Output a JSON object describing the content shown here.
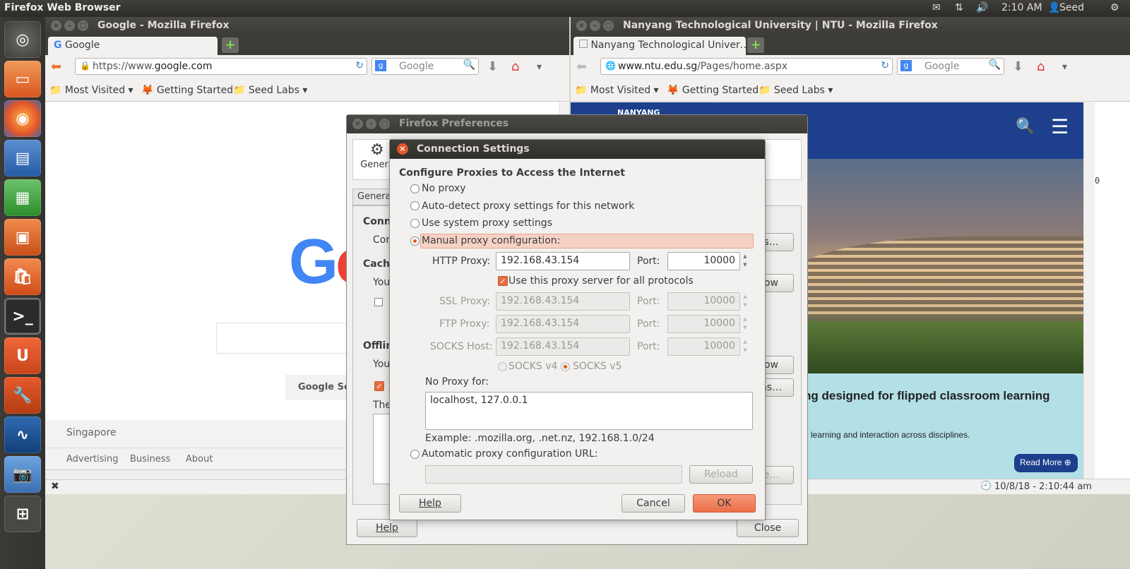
{
  "topbar": {
    "app_name": "Firefox Web Browser",
    "time": "2:10 AM",
    "user": "Seed"
  },
  "left_window": {
    "title": "Google - Mozilla Firefox",
    "tab": "Google",
    "url_prefix": "https://www.",
    "url_domain": "google.com",
    "search_placeholder": "Google",
    "bookmarks": [
      "Most Visited",
      "Getting Started",
      "Seed Labs"
    ],
    "content": {
      "logo": "Go",
      "search_button": "Google Sea",
      "footer_region": "Singapore",
      "footer_links": [
        "Advertising",
        "Business",
        "About"
      ]
    }
  },
  "right_window": {
    "title": "Nanyang Technological University | NTU - Mozilla Firefox",
    "tab": "Nanyang Technological Univer…",
    "url_domain": "www.ntu.edu.sg",
    "url_path": "/Pages/home.aspx",
    "search_placeholder": "Google",
    "bookmarks": [
      "Most Visited",
      "Getting Started",
      "Seed Labs"
    ],
    "content": {
      "logo": "NANYANG",
      "headline": "ng designed for flipped classroom learning",
      "sub": "e learning and interaction across disciplines.",
      "read_more": "Read More",
      "status_time": "10/8/18 - 2:10:44 am",
      "scroll_value": "0"
    }
  },
  "preferences": {
    "title": "Firefox Preferences",
    "tab_general": "Genera",
    "subtab": "Genera",
    "frag_conn": "Conn",
    "frag_con": "Con",
    "frag_cache": "Cache",
    "frag_you": "You",
    "frag_offline": "Offlin",
    "frag_you2": "You",
    "frag_the": "The",
    "frag_btn1": "s…",
    "frag_btn2": "ow",
    "frag_btn3": "ow",
    "frag_btn4": "ns…",
    "frag_btn5": "e…",
    "help": "Help",
    "close": "Close"
  },
  "connection": {
    "title": "Connection Settings",
    "heading": "Configure Proxies to Access the Internet",
    "opt_no_proxy": "No proxy",
    "opt_auto_detect": "Auto-detect proxy settings for this network",
    "opt_system": "Use system proxy settings",
    "opt_manual": "Manual proxy configuration:",
    "http_label": "HTTP Proxy:",
    "http_value": "192.168.43.154",
    "port_label": "Port:",
    "http_port": "10000",
    "use_all": "Use this proxy server for all protocols",
    "ssl_label": "SSL Proxy:",
    "ssl_value": "192.168.43.154",
    "ssl_port": "10000",
    "ftp_label": "FTP Proxy:",
    "ftp_value": "192.168.43.154",
    "ftp_port": "10000",
    "socks_label": "SOCKS Host:",
    "socks_value": "192.168.43.154",
    "socks_port": "10000",
    "socks_v4": "SOCKS v4",
    "socks_v5": "SOCKS v5",
    "no_proxy_label": "No Proxy for:",
    "no_proxy_value": "localhost, 127.0.0.1",
    "example": "Example: .mozilla.org, .net.nz, 192.168.1.0/24",
    "opt_auto_url": "Automatic proxy configuration URL:",
    "reload": "Reload",
    "help": "Help",
    "cancel": "Cancel",
    "ok": "OK"
  },
  "colors": {
    "accent": "#e95420",
    "ntu_blue": "#1d3f8c",
    "ntu_teal": "#b3dfe6"
  }
}
